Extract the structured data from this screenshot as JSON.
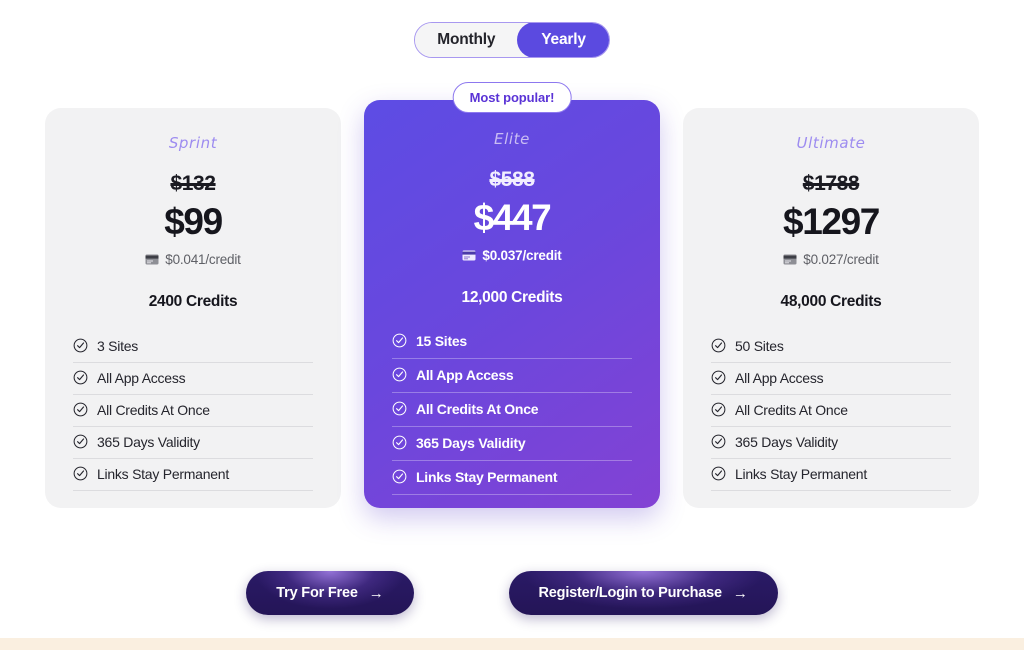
{
  "billing_toggle": {
    "options": [
      {
        "label": "Monthly",
        "active": false
      },
      {
        "label": "Yearly",
        "active": true
      }
    ]
  },
  "plans": [
    {
      "name": "Sprint",
      "badge": null,
      "price_original": "$132",
      "price_current": "$99",
      "per_credit": "$0.041/credit",
      "credits": "2400 Credits",
      "features": [
        "3 Sites",
        "All App Access",
        "All Credits At Once",
        "365 Days Validity",
        "Links Stay Permanent"
      ]
    },
    {
      "name": "Elite",
      "badge": "Most popular!",
      "price_original": "$588",
      "price_current": "$447",
      "per_credit": "$0.037/credit",
      "credits": "12,000 Credits",
      "features": [
        "15 Sites",
        "All App Access",
        "All Credits At Once",
        "365 Days Validity",
        "Links Stay Permanent"
      ]
    },
    {
      "name": "Ultimate",
      "badge": null,
      "price_original": "$1788",
      "price_current": "$1297",
      "per_credit": "$0.027/credit",
      "credits": "48,000 Credits",
      "features": [
        "50 Sites",
        "All App Access",
        "All Credits At Once",
        "365 Days Validity",
        "Links Stay Permanent"
      ]
    }
  ],
  "cta": {
    "try_free": "Try For Free",
    "register_login": "Register/Login to Purchase",
    "arrow": "→"
  },
  "icons": {
    "credit_card": "credit-card-icon",
    "check": "check-circle-icon"
  },
  "colors": {
    "accent": "#5b4ae0",
    "featured_gradient_start": "#5d4ce4",
    "featured_gradient_end": "#8342d4",
    "card_background": "#f2f2f3",
    "badge_text": "#5a33d6",
    "plan_name": "#9d8cf0",
    "cta_background": "#2a1a66",
    "bottom_band": "#faefe0"
  }
}
